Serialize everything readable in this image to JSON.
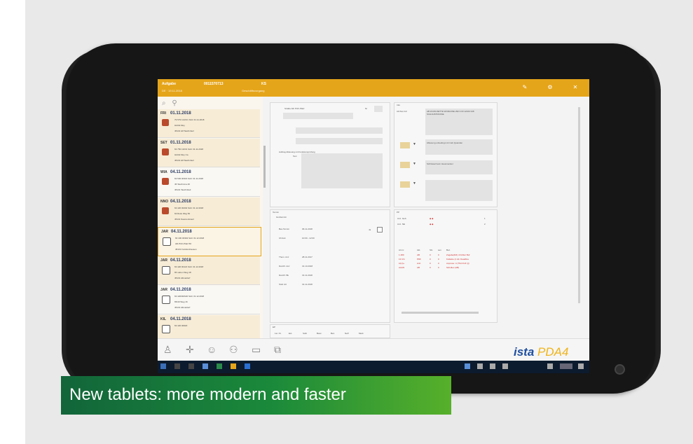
{
  "caption": {
    "text": "New tablets: more modern and faster"
  },
  "brand": {
    "name": "ista",
    "product": "PDA4"
  },
  "screen": {
    "title": "Aufgabe",
    "title_nr": "0011570713",
    "title_code": "KS",
    "sub_left": "DE · 19.11.2018",
    "sub_right": "Geschäftsvorgang"
  },
  "list": [
    {
      "day": "FRI",
      "date": "01.11.2018",
      "lines": [
        "79 579 114/1/1   SAC 31.11.2018",
        "HAUE Mey",
        "45131 HKTaschnbeil"
      ],
      "style": "orange",
      "icon": "filled"
    },
    {
      "day": "SET",
      "date": "01.11.2018",
      "lines": [
        "63 750 13/0/1   SAC 31.11.2018",
        "HAUE Mey Ca",
        "45131 HKTaschnbeil"
      ],
      "style": "orange",
      "icon": "filled"
    },
    {
      "day": "WIA",
      "date": "04.11.2018",
      "lines": [
        "63 530 00316   SAC 31.11.2018",
        "45 Taschnma 26",
        "45131 Taschnbeil"
      ],
      "style": "white",
      "icon": "filled"
    },
    {
      "day": "NNO",
      "date": "04.11.2018",
      "lines": [
        "63 420 00202   SAC 31.12.2018",
        "63 Rusk Weg 50",
        "45131 Naumentrweil"
      ],
      "style": "orange",
      "icon": "filled"
    },
    {
      "day": "JAR",
      "date": "04.11.2018",
      "lines": [
        "63 430 00302   SAC 31.12.2018",
        "Alb PUF-Platz 50",
        "45131 Funktionhausen"
      ],
      "style": "selected",
      "icon": "empty"
    },
    {
      "day": "JAR",
      "date": "04.11.2018",
      "lines": [
        "63 420 00121   SAC 31.12.2018",
        "65 neben Weg 18",
        "45131 Allmeldorf"
      ],
      "style": "orange",
      "icon": "empty"
    },
    {
      "day": "JAR",
      "date": "04.11.2018",
      "lines": [
        "63 420/00/620   SAC 31.12.2018",
        "65/40 Weg 16",
        "45131 Allmeldorf"
      ],
      "style": "white",
      "icon": "empty"
    },
    {
      "day": "KIL",
      "date": "04.11.2018",
      "lines": [
        "63 420 00620",
        "",
        ""
      ],
      "style": "orange",
      "icon": "empty"
    }
  ],
  "address_pane": {
    "street_label": "Straße Alb PUF-Platz",
    "nr_label": "Nr",
    "plz_label": "PLZ 45131",
    "ort_label": "Ort Funktionhausen",
    "auftrag_label": "Auftrag Ablesung mit Funktionsprüfung",
    "text_label": "Text"
  },
  "info_pane": {
    "title": "Info",
    "contact_label": "AGText 1/2",
    "contact_value": "AB ZUUM ZETTE WORLDNE 290 3.00 12100 348 SCHUHSTRASSE",
    "note1": "Ablesung unbedingt mit Insb Quandan",
    "note2": "Schlüssel beim Hausmeister"
  },
  "termin_pane": {
    "title": "Termin",
    "subtitle": "Grobtermin",
    "rows": [
      {
        "label": "Bes.Termin",
        "value": "06.11.2018"
      },
      {
        "label": "Uhrzeit",
        "value": "10:00  -  12:00"
      },
      {
        "label": "Them. Anz",
        "value": "28.11.2017"
      },
      {
        "label": "Darchf. Anz",
        "value": "31.10.2018"
      },
      {
        "label": "Darchf. Bk",
        "value": "31.11.2018"
      },
      {
        "label": "Stob AU",
        "value": "31.11.2018"
      }
    ],
    "ja_label": "Ja"
  },
  "pp_pane": {
    "title": "PP",
    "anz_geb_label": "Anz. Geb.",
    "anz_geb_value": "1",
    "anz_nf_label": "Anz. NE",
    "anz_nf_value": "2",
    "headers": [
      "Art.nr.",
      "Akt.",
      "SG",
      "sen",
      "Bez."
    ],
    "rows": [
      [
        "1 480",
        "AB",
        "0",
        "0",
        "Zugabe(RZ) 4 Fühler Buf"
      ],
      [
        "13 UG",
        "PDF",
        "0",
        "0",
        "Kollekte (1 Att. Deadline"
      ],
      [
        "Ll(U)+",
        "Anh",
        "0",
        "0",
        "Anpruse: 4 (TS4 FUF Q)"
      ],
      [
        "AAAN",
        "AB",
        "0",
        "0",
        "Schullex (AB)"
      ]
    ]
  },
  "ep_pane": {
    "title": "EP",
    "headers": [
      "Lst. Nr.",
      "Ext.",
      "Sollt",
      "Besc.",
      "Bez.",
      "Neff",
      "Merk"
    ]
  },
  "colors": {
    "accent": "#e5a51a",
    "caption_start": "#12653a",
    "caption_end": "#57b02a",
    "brand_blue": "#1f4fa0",
    "brand_yellow": "#f0b41a"
  },
  "toolbar_icons": [
    "person-icon",
    "crosshair-icon",
    "user-icon",
    "group-icon",
    "document-icon",
    "new-icon"
  ]
}
